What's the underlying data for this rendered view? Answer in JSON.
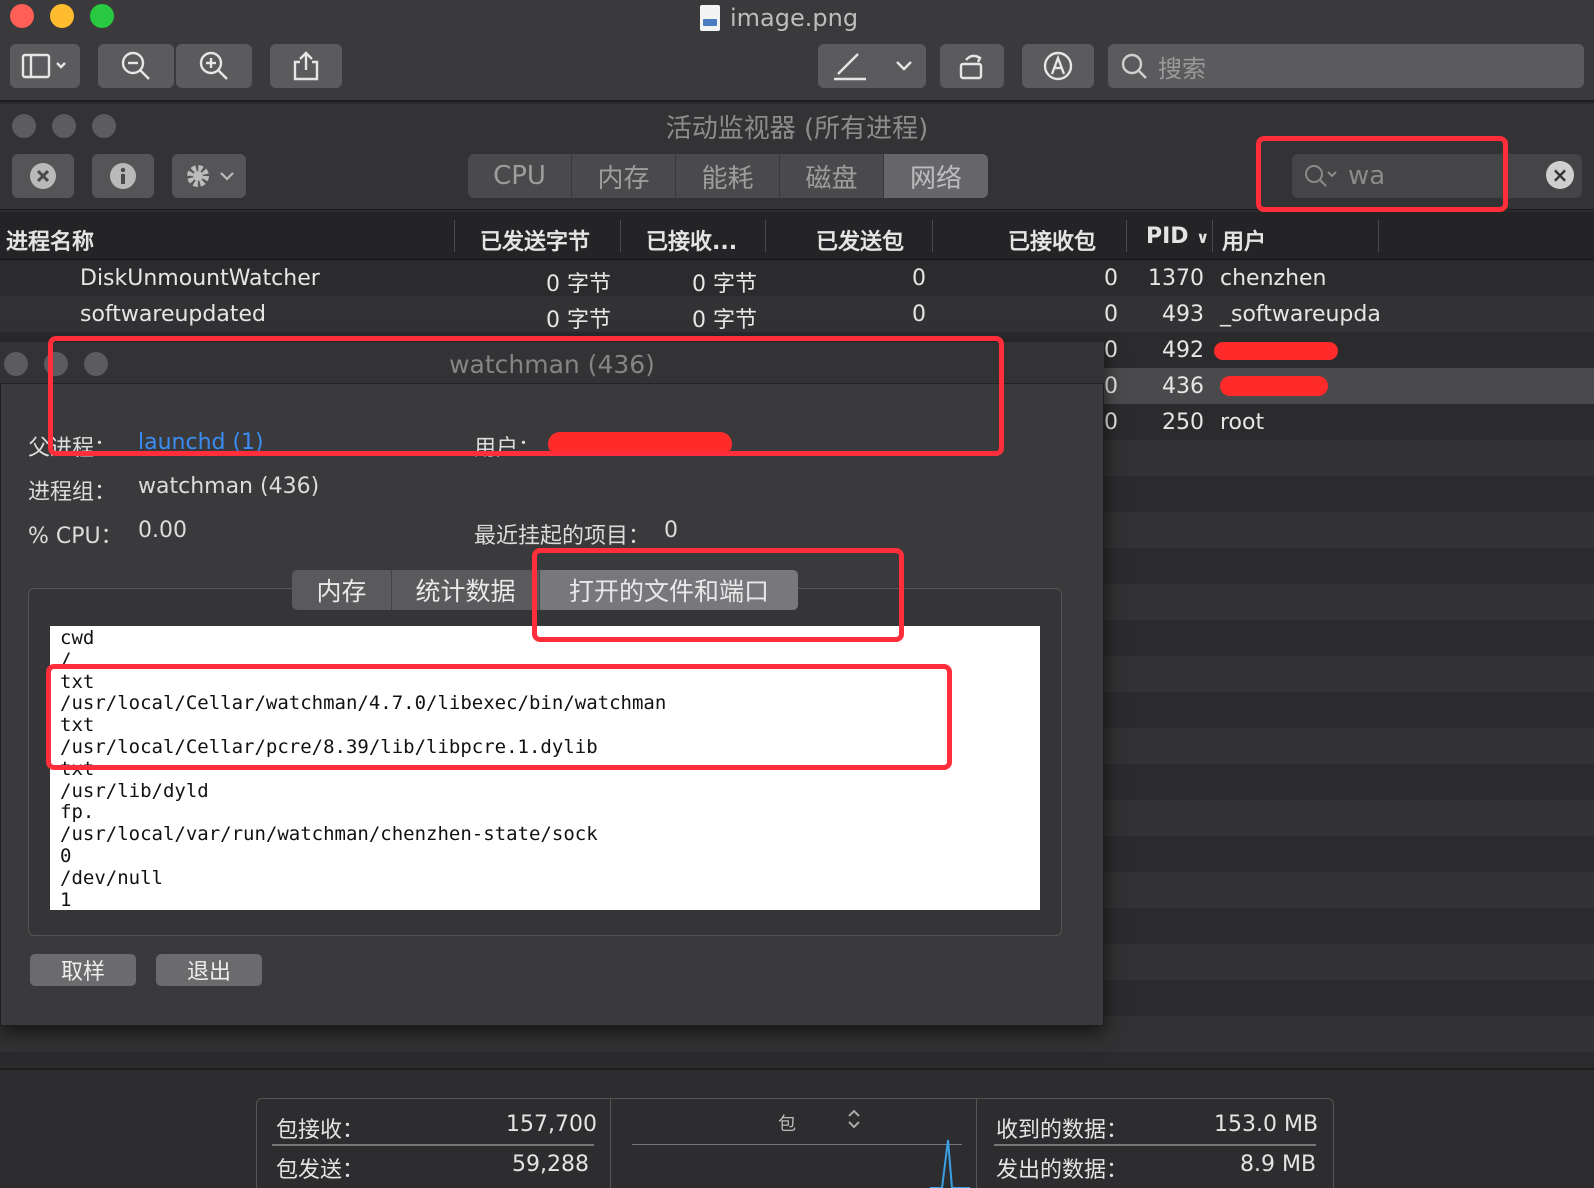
{
  "preview": {
    "filename": "image.png",
    "search_placeholder": "搜索"
  },
  "monitor": {
    "title": "活动监视器 (所有进程)",
    "tabs": [
      "CPU",
      "内存",
      "能耗",
      "磁盘",
      "网络"
    ],
    "active_tab": "网络",
    "search_value": "wa",
    "columns": {
      "name": "进程名称",
      "sent_bytes": "已发送字节",
      "recv_bytes": "已接收...",
      "sent_packets": "已发送包",
      "recv_packets": "已接收包",
      "pid": "PID",
      "user": "用户"
    },
    "rows": [
      {
        "name": "DiskUnmountWatcher",
        "sent": "0 字节",
        "recv": "0 字节",
        "sp": "0",
        "rp": "0",
        "pid": "1370",
        "user": "chenzhen"
      },
      {
        "name": "softwareupdated",
        "sent": "0 字节",
        "recv": "0 字节",
        "sp": "0",
        "rp": "0",
        "pid": "493",
        "user": "_softwareupda"
      },
      {
        "name": "",
        "sent": "",
        "recv": "",
        "sp": "",
        "rp": "0",
        "pid": "492",
        "user": ""
      },
      {
        "name": "",
        "sent": "",
        "recv": "",
        "sp": "",
        "rp": "0",
        "pid": "436",
        "user": ""
      },
      {
        "name": "",
        "sent": "",
        "recv": "",
        "sp": "",
        "rp": "0",
        "pid": "250",
        "user": "root"
      }
    ]
  },
  "dialog": {
    "title": "watchman (436)",
    "parent_label": "父进程：",
    "parent_value": "launchd (1)",
    "user_label": "用户：",
    "group_label": "进程组：",
    "group_value": "watchman (436)",
    "cpu_label": "% CPU：",
    "cpu_value": "0.00",
    "hung_label": "最近挂起的项目：",
    "hung_value": "0",
    "tabs": [
      "内存",
      "统计数据",
      "打开的文件和端口"
    ],
    "active_tab": "打开的文件和端口",
    "files": [
      "cwd",
      "/",
      "txt",
      "/usr/local/Cellar/watchman/4.7.0/libexec/bin/watchman",
      "txt",
      "/usr/local/Cellar/pcre/8.39/lib/libpcre.1.dylib",
      "txt",
      "/usr/lib/dyld",
      "fp.",
      "/usr/local/var/run/watchman/chenzhen-state/sock",
      "0",
      "/dev/null",
      "1"
    ],
    "sample_button": "取样",
    "quit_button": "退出"
  },
  "footer": {
    "packets_in_label": "包接收：",
    "packets_in_value": "157,700",
    "packets_out_label": "包发送：",
    "packets_out_value": "59,288",
    "chart_label": "包",
    "data_in_label": "收到的数据：",
    "data_in_value": "153.0 MB",
    "data_out_label": "发出的数据：",
    "data_out_value": "8.9 MB"
  },
  "colors": {
    "annotation_red": "#ff2e3a",
    "link_blue": "#3b8cf2",
    "redaction_red": "#ff1f1f"
  }
}
